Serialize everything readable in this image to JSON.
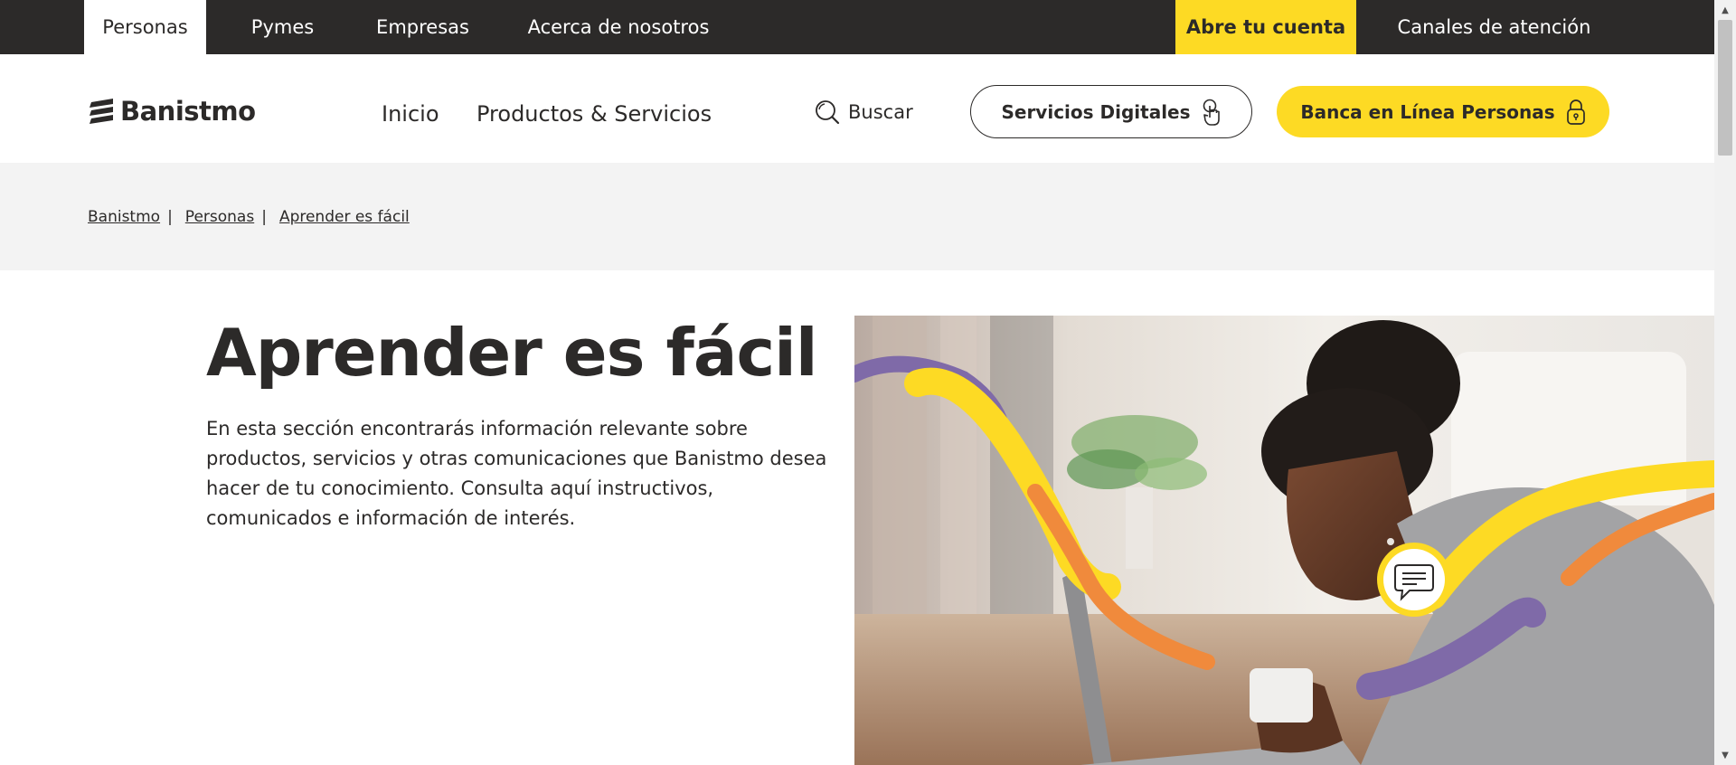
{
  "topbar": {
    "tabs": [
      "Personas",
      "Pymes",
      "Empresas",
      "Acerca de nosotros"
    ],
    "cta": "Abre tu cuenta",
    "channels": "Canales de atención"
  },
  "header": {
    "logo": "Banistmo",
    "nav": [
      "Inicio",
      "Productos & Servicios"
    ],
    "search_label": "Buscar",
    "digital_services": "Servicios Digitales",
    "online_banking": "Banca en Línea Personas"
  },
  "breadcrumb": [
    "Banistmo",
    "Personas",
    "Aprender es fácil"
  ],
  "hero": {
    "title": "Aprender es fácil",
    "description": "En esta sección encontrarás información relevante sobre productos, servicios y otras comunicaciones que Banistmo desea hacer de tu conocimiento. Consulta aquí instructivos, comunicados e información de interés."
  },
  "colors": {
    "brand_dark": "#2c2a29",
    "brand_yellow": "#fdda24",
    "accent_purple": "#7f6aa8",
    "accent_orange": "#f08a3c"
  },
  "icons": [
    "banistmo-logo-icon",
    "search-icon",
    "touch-icon",
    "lock-icon",
    "chat-icon"
  ]
}
